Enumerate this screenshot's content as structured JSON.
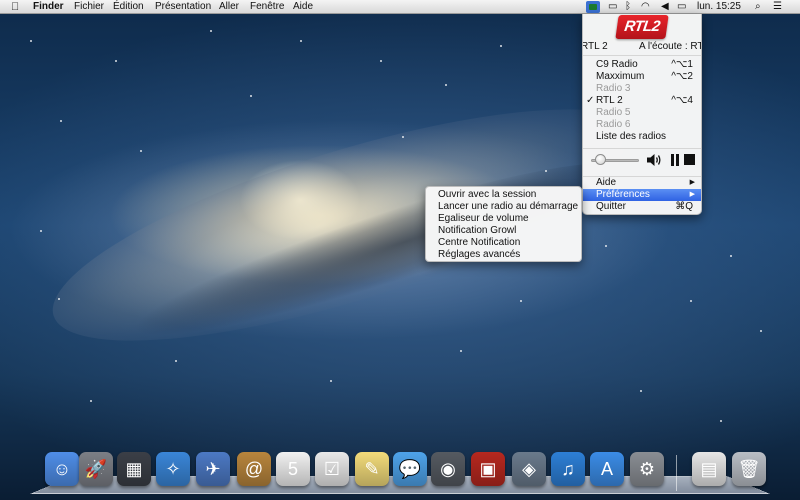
{
  "menubar": {
    "finder_label": "Finder",
    "menus": [
      "Fichier",
      "Édition",
      "Présentation",
      "Aller",
      "Fenêtre",
      "Aide"
    ],
    "clock": "lun. 15:25"
  },
  "radio_menu": {
    "logo_text": "RTL2",
    "now_station": "RTL 2",
    "now_playing": "A l'écoute : RTL",
    "stations": [
      {
        "label": "C9 Radio",
        "shortcut": "^⌥1",
        "enabled": true,
        "checked": false
      },
      {
        "label": "Maxximum",
        "shortcut": "^⌥2",
        "enabled": true,
        "checked": false
      },
      {
        "label": "Radio 3",
        "shortcut": "",
        "enabled": false,
        "checked": false
      },
      {
        "label": "RTL 2",
        "shortcut": "^⌥4",
        "enabled": true,
        "checked": true
      },
      {
        "label": "Radio 5",
        "shortcut": "",
        "enabled": false,
        "checked": false
      },
      {
        "label": "Radio 6",
        "shortcut": "",
        "enabled": false,
        "checked": false
      }
    ],
    "list_label": "Liste des radios",
    "check_mark": "✓",
    "volume_level": 0.1,
    "help_label": "Aide",
    "prefs_label": "Préférences",
    "quit_label": "Quitter",
    "quit_shortcut": "⌘Q",
    "submenu_arrow": "▶"
  },
  "prefs_menu": {
    "items": [
      "Ouvrir avec la session",
      "Lancer une radio au démarrage",
      "Egaliseur de volume",
      "Notification Growl",
      "Centre Notification",
      "Réglages avancés"
    ]
  },
  "dock": {
    "apps": [
      {
        "name": "finder-icon",
        "glyph": "☺",
        "color": "#4f8ee8"
      },
      {
        "name": "launchpad-icon",
        "glyph": "🚀",
        "color": "#7c7f86"
      },
      {
        "name": "mission-control-icon",
        "glyph": "▦",
        "color": "#3b3f47"
      },
      {
        "name": "safari-icon",
        "glyph": "✧",
        "color": "#3a86d8"
      },
      {
        "name": "mail-icon",
        "glyph": "✈",
        "color": "#4c79c4"
      },
      {
        "name": "contacts-icon",
        "glyph": "@",
        "color": "#b8853d"
      },
      {
        "name": "calendar-icon",
        "glyph": "5",
        "color": "#f1f1f1"
      },
      {
        "name": "reminders-icon",
        "glyph": "☑",
        "color": "#e9e9e9"
      },
      {
        "name": "notes-icon",
        "glyph": "✎",
        "color": "#f2db7a"
      },
      {
        "name": "messages-icon",
        "glyph": "💬",
        "color": "#4ea3ea"
      },
      {
        "name": "facetime-icon",
        "glyph": "◉",
        "color": "#555a61"
      },
      {
        "name": "photo-booth-icon",
        "glyph": "▣",
        "color": "#b6281f"
      },
      {
        "name": "iphoto-icon",
        "glyph": "◈",
        "color": "#6a7a8c"
      },
      {
        "name": "itunes-icon",
        "glyph": "♫",
        "color": "#2d7fd6"
      },
      {
        "name": "app-store-icon",
        "glyph": "A",
        "color": "#3b8ce6"
      },
      {
        "name": "system-preferences-icon",
        "glyph": "⚙",
        "color": "#8a8e94"
      },
      {
        "name": "documents-stack-icon",
        "glyph": "▤",
        "color": "#e6e6e6"
      },
      {
        "name": "trash-icon",
        "glyph": "🗑",
        "color": "#b9bec5"
      }
    ]
  }
}
